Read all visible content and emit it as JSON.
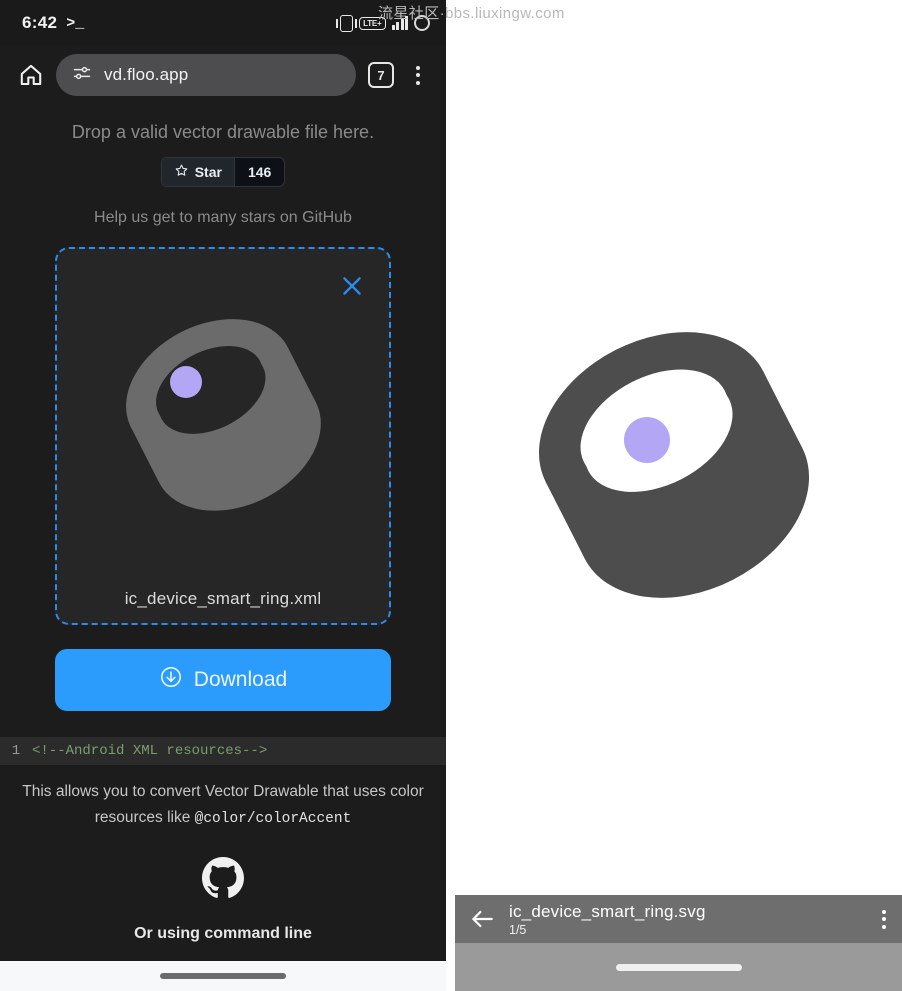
{
  "watermark": "流星社区·bbs.liuxingw.com",
  "colors": {
    "phone_bg": "#1c1c1c",
    "accent_blue": "#2b9bfc",
    "dropzone_border": "#2b8cf0",
    "ring_gray_large": "#4d4d4d",
    "ring_gray_small": "#6b6b6b",
    "ring_dot_purple": "#b3a6f5",
    "code_green": "#77a06a",
    "viewer_bar_gray": "#6e6e6e"
  },
  "statusbar": {
    "time": "6:42",
    "prompt_icon": "terminal-prompt-icon",
    "icons": [
      "vibrate-icon",
      "lte-plus-icon",
      "signal-bars-icon",
      "battery-circle-icon"
    ],
    "lte_label": "LTE+"
  },
  "browser": {
    "home_icon": "home-icon",
    "site_settings_icon": "tune-sliders-icon",
    "url": "vd.floo.app",
    "tab_count": "7",
    "menu_icon": "overflow-menu-icon"
  },
  "page": {
    "drop_hint": "Drop a valid vector drawable file here.",
    "star_button": {
      "icon": "star-icon",
      "label": "Star",
      "count": "146"
    },
    "help_text": "Help us get to many stars on GitHub",
    "dropzone": {
      "close_icon": "close-icon",
      "preview_icon": "smart-ring-icon",
      "filename": "ic_device_smart_ring.xml"
    },
    "download_button": {
      "icon": "download-circle-icon",
      "label": "Download"
    },
    "code": {
      "line_number": "1",
      "line_text": "<!--Android XML resources-->"
    },
    "description_line1": "This allows you to convert Vector Drawable that uses color",
    "description_line2_prefix": "resources like ",
    "description_line2_code": "@color/colorAccent",
    "github_icon": "github-icon",
    "command_line_text": "Or using command line"
  },
  "viewer": {
    "artwork_icon": "smart-ring-icon",
    "back_icon": "back-arrow-icon",
    "filename": "ic_device_smart_ring.svg",
    "position": "1/5",
    "menu_icon": "overflow-menu-icon"
  }
}
